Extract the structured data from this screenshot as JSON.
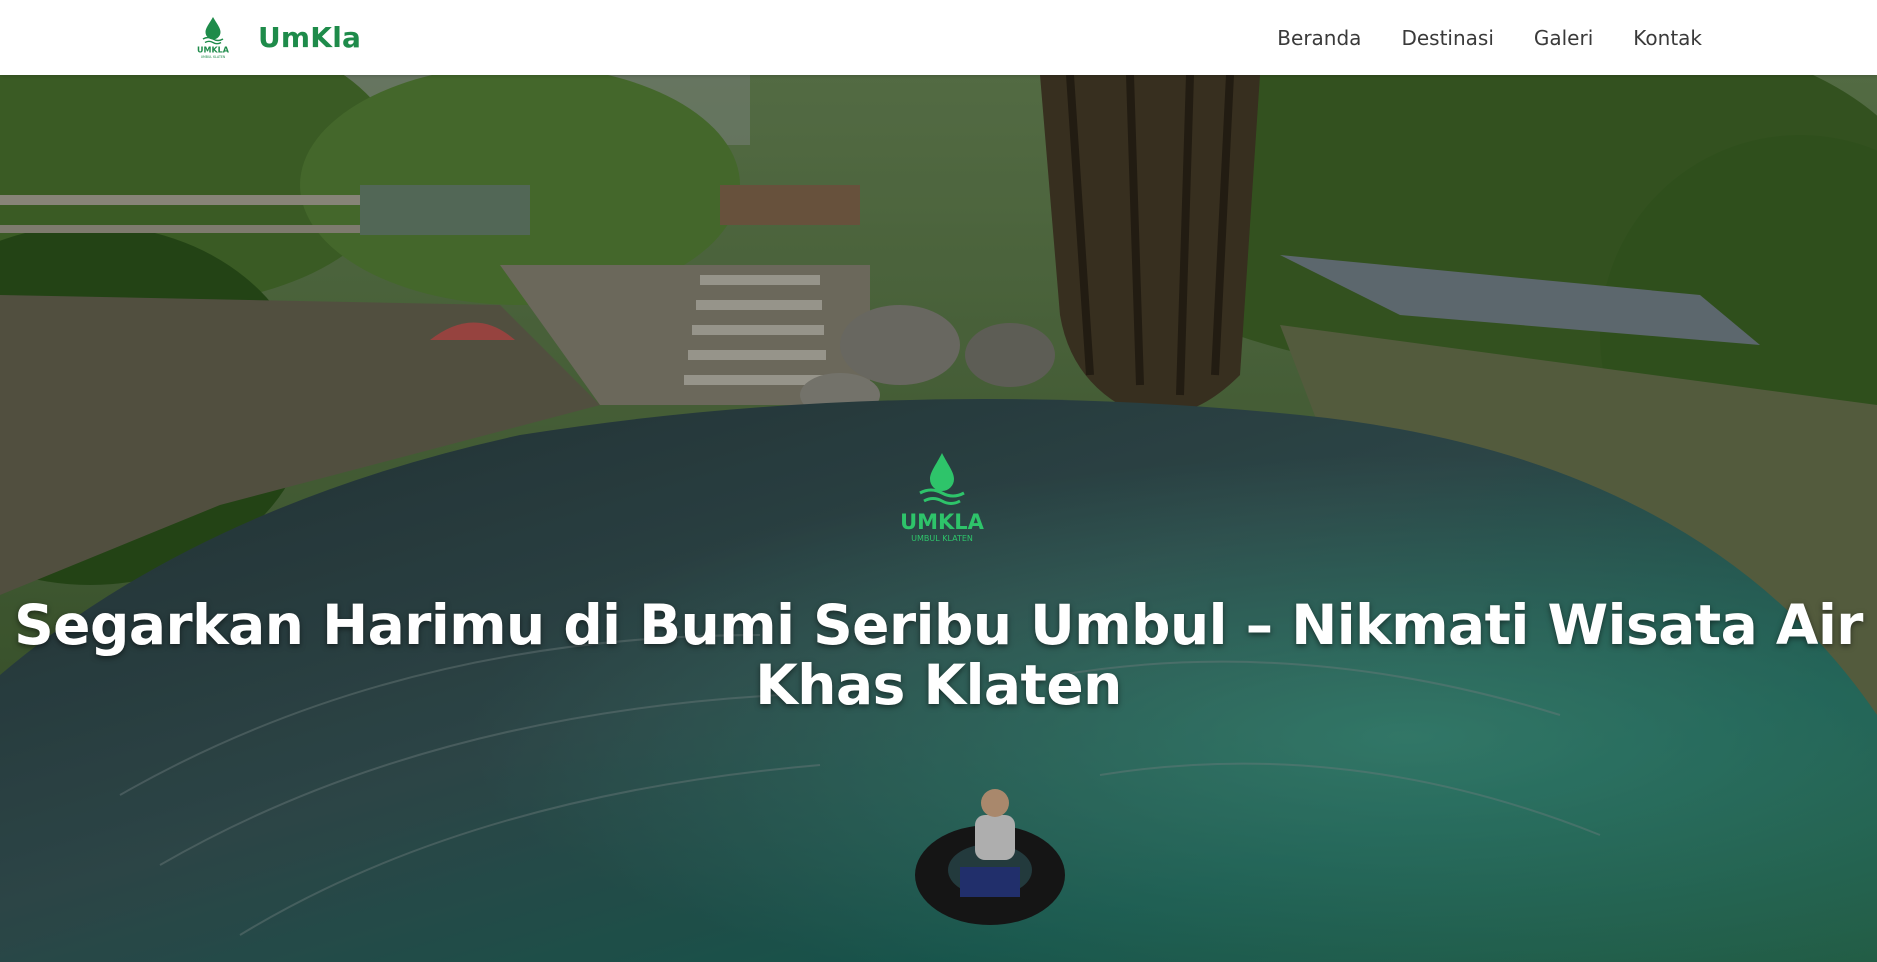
{
  "brand": {
    "name": "UmKla",
    "logo_text": "UMKLA",
    "logo_subtext": "UMBUL KLATEN",
    "color": "#1e8b4a"
  },
  "nav": {
    "items": [
      {
        "label": "Beranda"
      },
      {
        "label": "Destinasi"
      },
      {
        "label": "Galeri"
      },
      {
        "label": "Kontak"
      }
    ]
  },
  "hero": {
    "title": "Segarkan Harimu di Bumi Seribu Umbul – Nikmati Wisata Air Khas Klaten",
    "logo_text": "UMKLA",
    "logo_subtext": "UMBUL KLATEN",
    "logo_color": "#2ec46a"
  }
}
